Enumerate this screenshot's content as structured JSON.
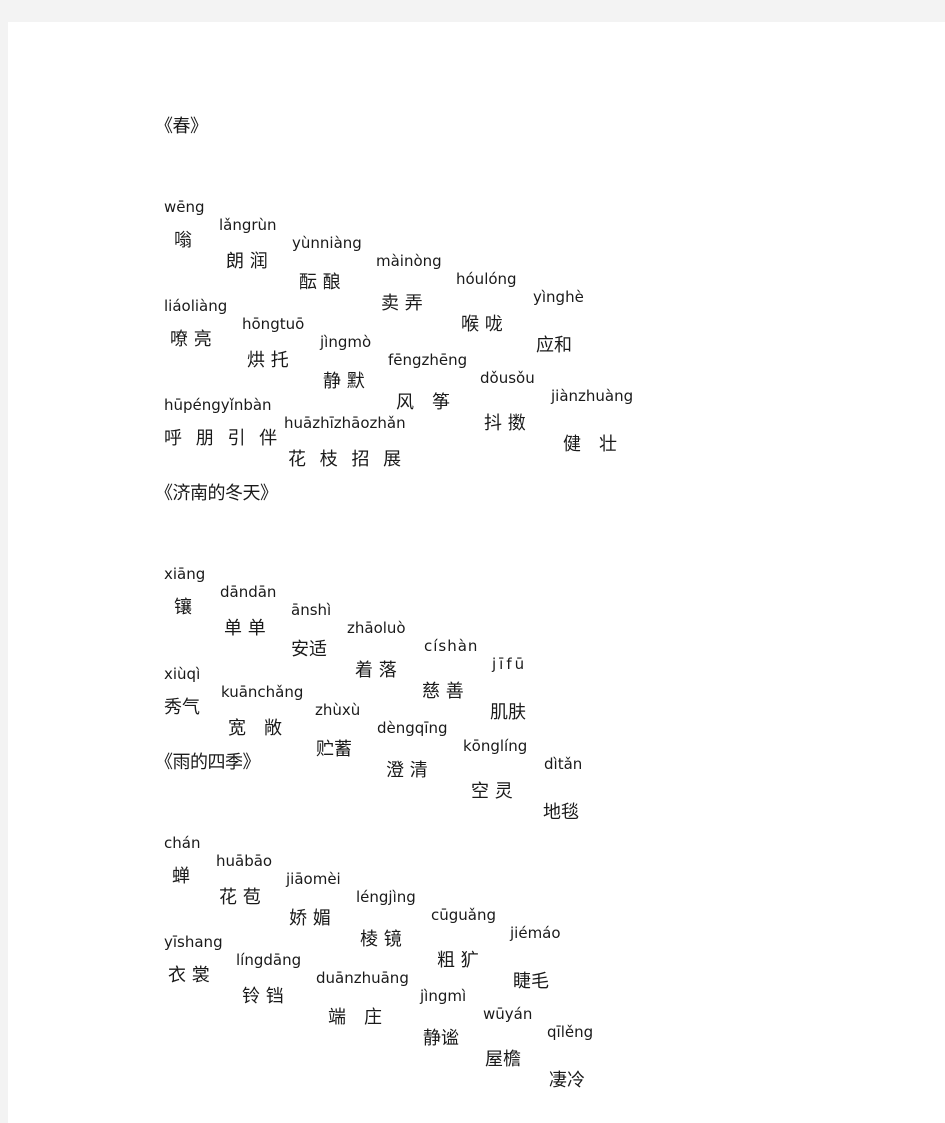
{
  "sections": [
    {
      "title": "《春》",
      "rows": [
        {
          "pinyin": [
            "wēng",
            "lǎngrùn",
            "yùnniàng",
            "màinòng",
            "hóulóng",
            "yìnghè"
          ],
          "hanzi": [
            "嗡",
            "朗 润",
            "酝 酿",
            "卖 弄",
            "喉 咙",
            "应和"
          ]
        },
        {
          "pinyin": [
            "liáoliàng",
            "hōngtuō",
            "jìngmò",
            "fēngzhēng",
            "dǒusǒu",
            "jiànzhuàng"
          ],
          "hanzi": [
            "嘹 亮",
            "烘 托",
            "静 默",
            "风　筝",
            "抖 擞",
            "健　壮"
          ]
        },
        {
          "pinyin": [
            "hūpéngyǐnbàn",
            "huāzhīzhāozhǎn"
          ],
          "hanzi": [
            "呼 朋 引 伴",
            "花 枝 招 展"
          ]
        }
      ]
    },
    {
      "title": "《济南的冬天》",
      "rows": [
        {
          "pinyin": [
            "xiāng",
            "dāndān",
            "ānshì",
            "zhāoluò",
            "císhàn",
            "jīfū"
          ],
          "hanzi": [
            "镶",
            "单 单",
            "安适",
            "着 落",
            "慈 善",
            "肌肤"
          ]
        },
        {
          "pinyin": [
            "xiùqì",
            "kuānchǎng",
            "zhùxù",
            "dèngqīng",
            "kōnglíng",
            "dìtǎn"
          ],
          "hanzi": [
            "秀气",
            "宽　敞",
            "贮蓄",
            "澄 清",
            "空 灵",
            "地毯"
          ]
        }
      ]
    },
    {
      "title": "《雨的四季》",
      "rows": [
        {
          "pinyin": [
            "chán",
            "huābāo",
            "jiāomèi",
            "léngjìng",
            "cūguǎng",
            "jiémáo"
          ],
          "hanzi": [
            "蝉",
            "花 苞",
            "娇 媚",
            "棱 镜",
            "粗 犷",
            "睫毛"
          ]
        },
        {
          "pinyin": [
            "yīshang",
            "língdāng",
            "duānzhuāng",
            "jìngmì",
            "wūyán",
            "qīlěng"
          ],
          "hanzi": [
            "衣 裳",
            "铃 铛",
            "端　庄",
            "静谧",
            "屋檐",
            "凄冷"
          ]
        }
      ]
    }
  ]
}
